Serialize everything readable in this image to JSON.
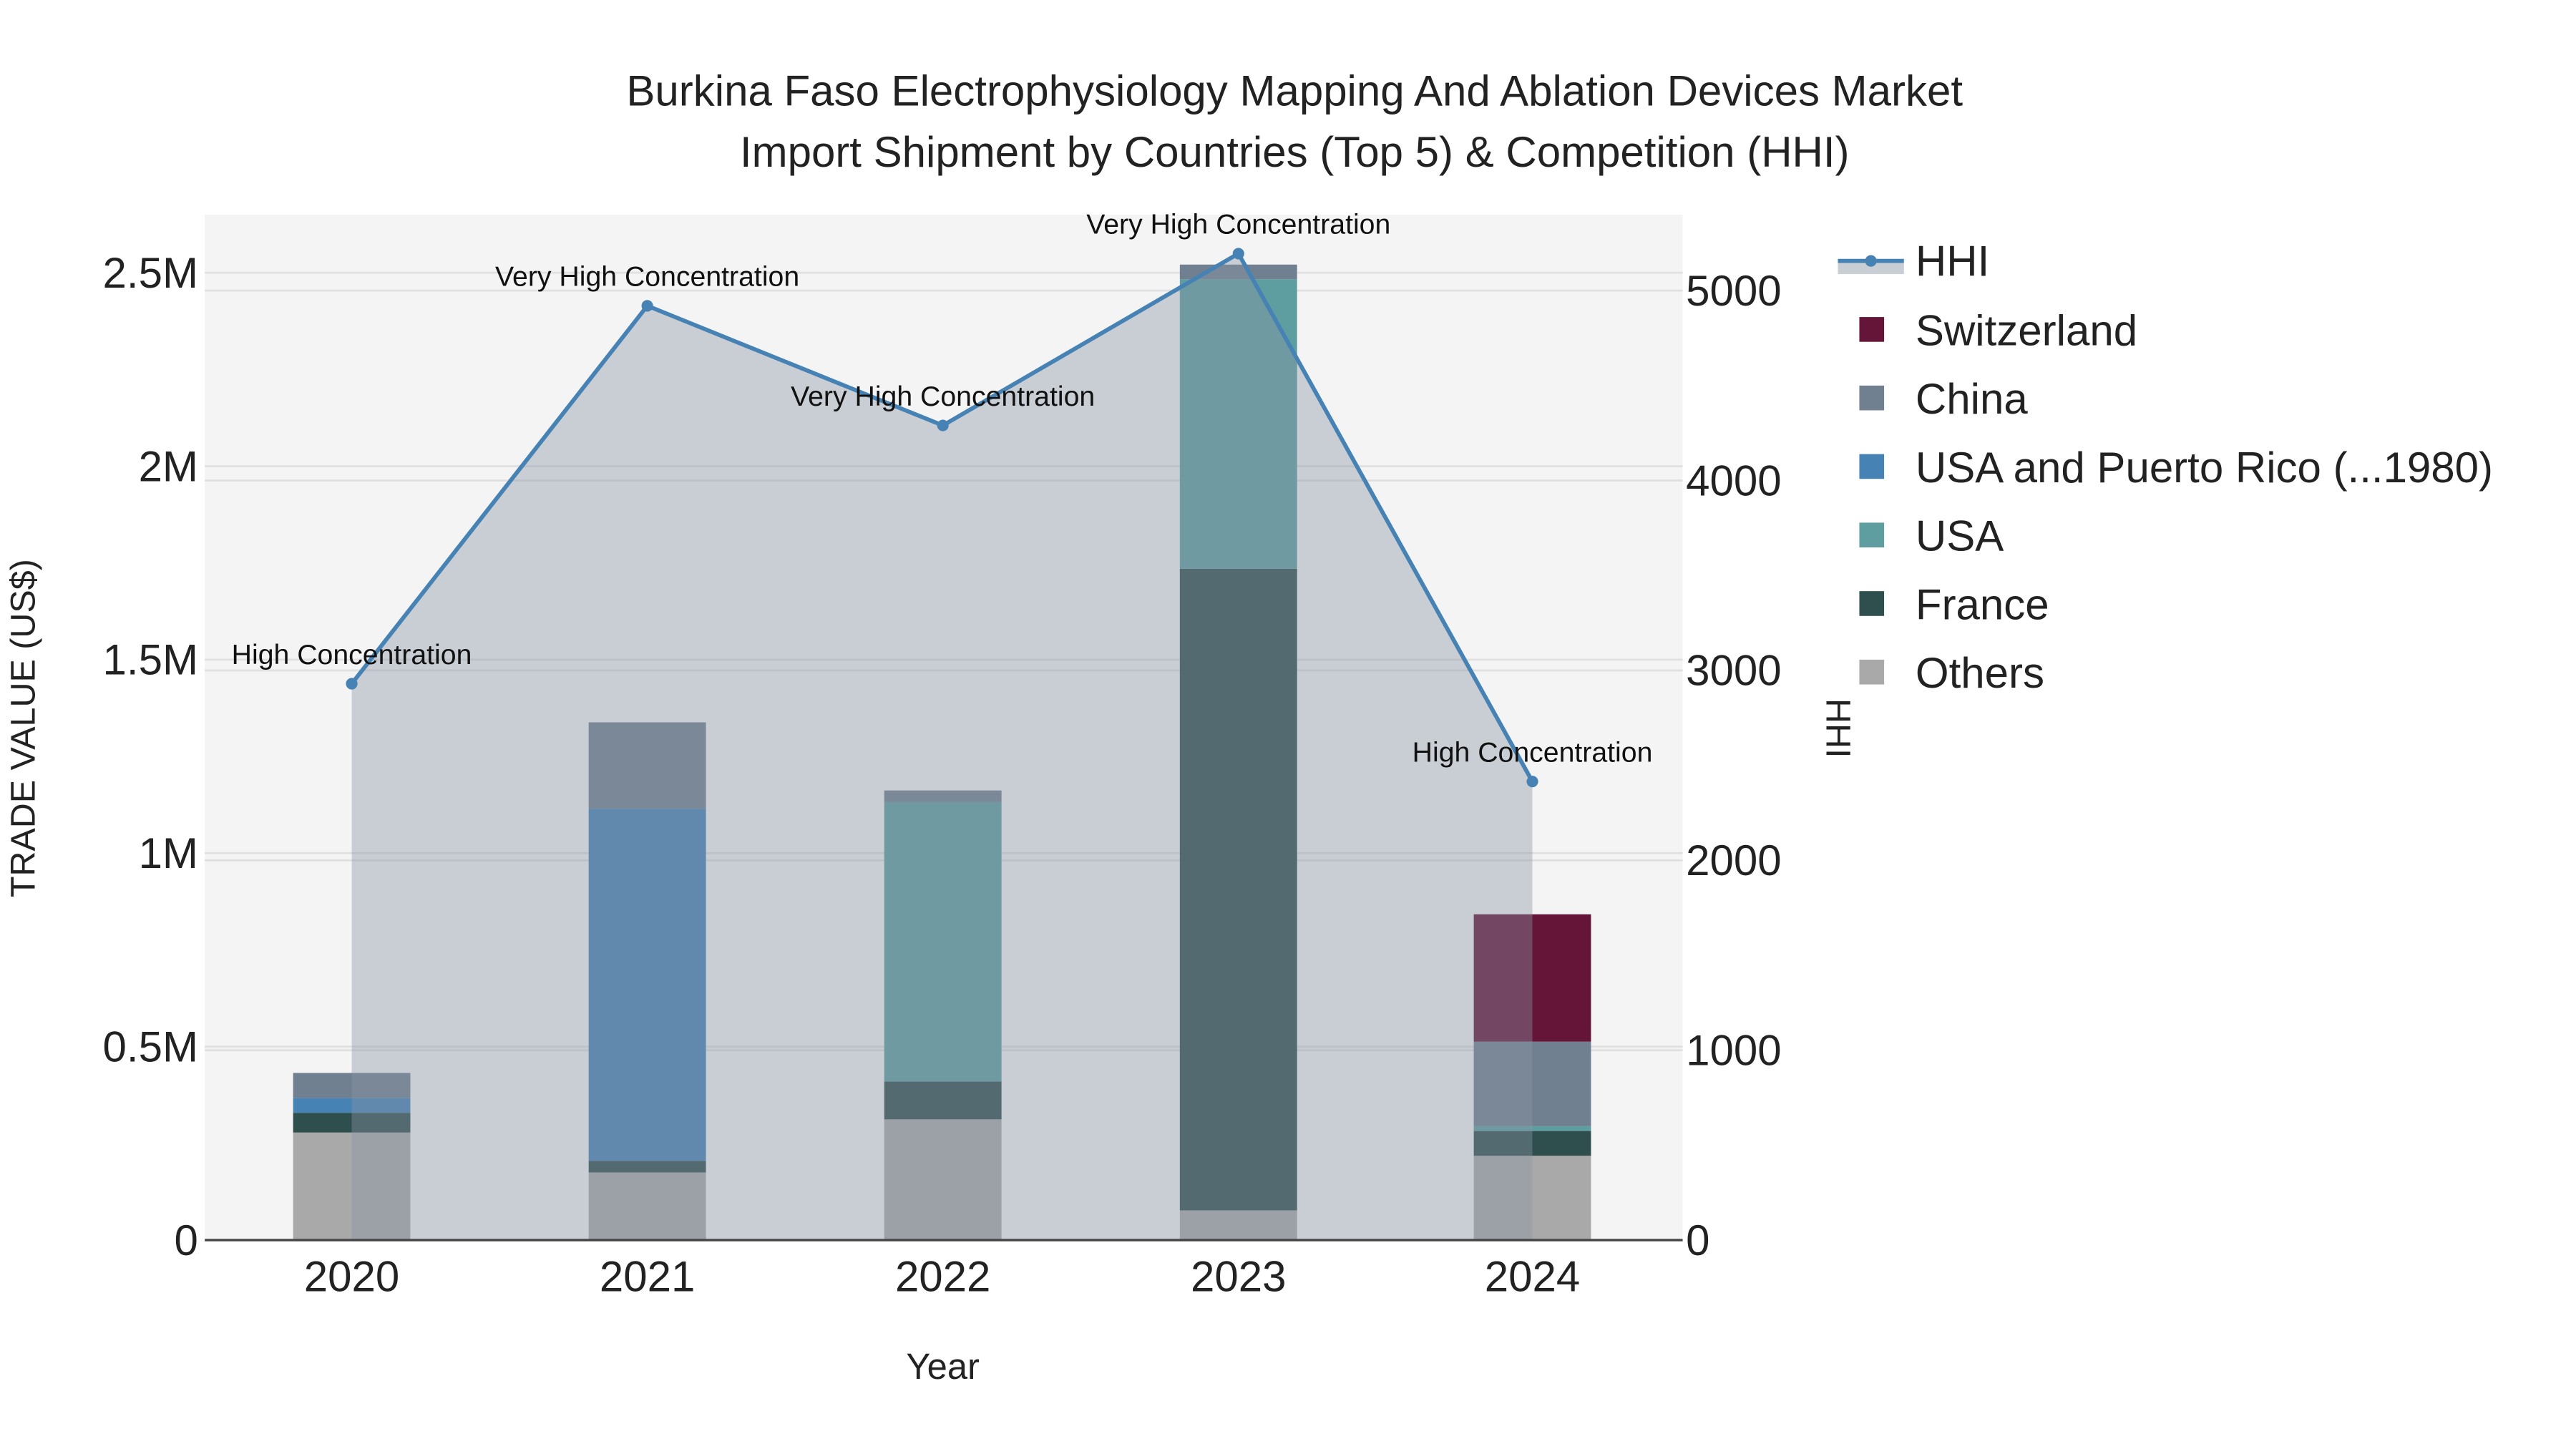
{
  "chart_data": {
    "type": "bar",
    "title_line1": "Burkina Faso Electrophysiology Mapping And Ablation Devices Market",
    "title_line2": "Import Shipment by Countries (Top 5) & Competition (HHI)",
    "xlabel": "Year",
    "ylabel": "TRADE VALUE (US$)",
    "y2label": "HHI",
    "ylim": [
      0,
      2650000
    ],
    "y2lim": [
      0,
      5400
    ],
    "yticks": [
      {
        "v": 0,
        "label": "0"
      },
      {
        "v": 500000,
        "label": "0.5M"
      },
      {
        "v": 1000000,
        "label": "1M"
      },
      {
        "v": 1500000,
        "label": "1.5M"
      },
      {
        "v": 2000000,
        "label": "2M"
      },
      {
        "v": 2500000,
        "label": "2.5M"
      }
    ],
    "y2ticks": [
      {
        "v": 0,
        "label": "0"
      },
      {
        "v": 1000,
        "label": "1000"
      },
      {
        "v": 2000,
        "label": "2000"
      },
      {
        "v": 3000,
        "label": "3000"
      },
      {
        "v": 4000,
        "label": "4000"
      },
      {
        "v": 5000,
        "label": "5000"
      }
    ],
    "categories": [
      "2020",
      "2021",
      "2022",
      "2023",
      "2024"
    ],
    "stacked": true,
    "series": [
      {
        "name": "Others",
        "color": "#a9a9a9",
        "values": [
          278000,
          175000,
          312000,
          77000,
          218000
        ]
      },
      {
        "name": "France",
        "color": "#2f4f4f",
        "values": [
          51000,
          30000,
          98000,
          1658000,
          64000
        ]
      },
      {
        "name": "USA",
        "color": "#5f9ea0",
        "values": [
          0,
          0,
          722000,
          748000,
          13000
        ]
      },
      {
        "name": "USA and Puerto Rico (...1980)",
        "color": "#4682b4",
        "values": [
          38000,
          910000,
          0,
          0,
          0
        ]
      },
      {
        "name": "China",
        "color": "#708090",
        "values": [
          65000,
          223000,
          30000,
          38000,
          218000
        ]
      },
      {
        "name": "Switzerland",
        "color": "#641538",
        "values": [
          0,
          0,
          0,
          0,
          329000
        ]
      }
    ],
    "hhi": {
      "name": "HHI",
      "color": "#4682b4",
      "values": [
        2930,
        4920,
        4290,
        5195,
        2415
      ],
      "annotations": [
        "High Concentration",
        "Very High Concentration",
        "Very High Concentration",
        "Very High Concentration",
        "High Concentration"
      ]
    },
    "legend_placement": "right",
    "legend_order": [
      "HHI",
      "Switzerland",
      "China",
      "USA and Puerto Rico (...1980)",
      "USA",
      "France",
      "Others"
    ]
  }
}
